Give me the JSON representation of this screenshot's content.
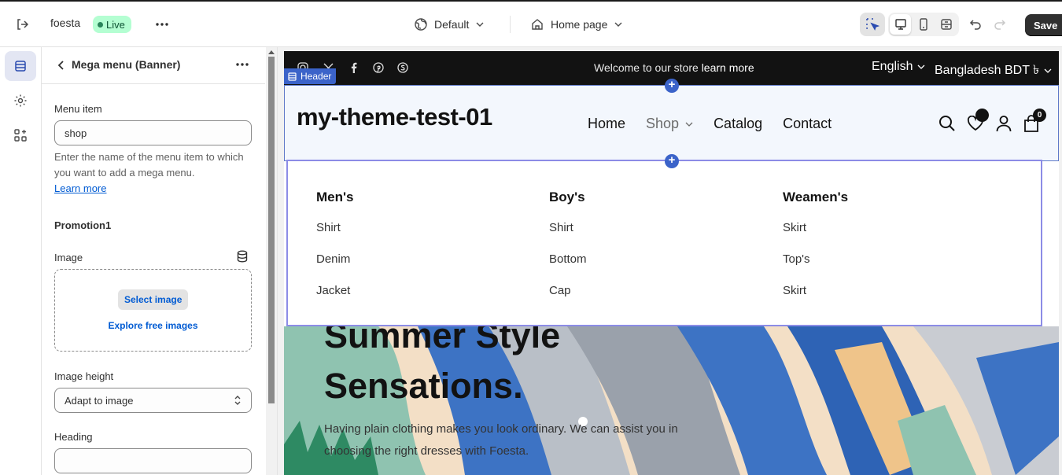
{
  "topbar": {
    "store_name": "foesta",
    "live_label": "Live",
    "theme_label": "Default",
    "page_label": "Home page",
    "save_label": "Save"
  },
  "panel": {
    "title": "Mega menu (Banner)",
    "menu_item_label": "Menu item",
    "menu_item_value": "shop",
    "help_text": "Enter the name of the menu item to which you want to add a mega menu.",
    "learn_more": "Learn more",
    "promotion_heading": "Promotion1",
    "image_label": "Image",
    "select_image": "Select image",
    "explore_images": "Explore free images",
    "image_height_label": "Image height",
    "image_height_value": "Adapt to image",
    "heading_label": "Heading",
    "heading_value": ""
  },
  "preview": {
    "announcement": {
      "text": "Welcome to our store",
      "link": "learn more",
      "language": "English",
      "currency": "Bangladesh BDT ৳"
    },
    "header_tag": "Header",
    "logo": "my-theme-test-01",
    "nav": {
      "home": "Home",
      "shop": "Shop",
      "catalog": "Catalog",
      "contact": "Contact"
    },
    "cart_count": "0",
    "mega_menu": [
      {
        "heading": "Men's",
        "items": [
          "Shirt",
          "Denim",
          "Jacket"
        ]
      },
      {
        "heading": "Boy's",
        "items": [
          "Shirt",
          "Bottom",
          "Cap"
        ]
      },
      {
        "heading": "Weamen's",
        "items": [
          "Skirt",
          "Top's",
          "Skirt"
        ]
      }
    ],
    "hero": {
      "title_line1": "Summer Style",
      "title_line2": "Sensations.",
      "text": "Having plain clothing makes you look ordinary. We can assist you in choosing the right dresses with Foesta."
    }
  },
  "colors": {
    "accent": "#3b63c9",
    "live_badge": "#b4fed2",
    "mega_outline": "#8c8ce6"
  }
}
